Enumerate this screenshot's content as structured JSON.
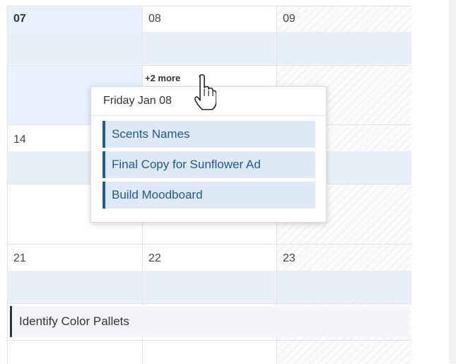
{
  "calendar": {
    "days": {
      "d07": "07",
      "d08": "08",
      "d09": "09",
      "d14": "14",
      "d21": "21",
      "d22": "22",
      "d23": "23"
    },
    "more_link": "+2 more",
    "long_event": "Identify Color Pallets"
  },
  "popup": {
    "title": "Friday Jan 08",
    "events": [
      {
        "label": "Scents Names"
      },
      {
        "label": "Final Copy for Sunflower Ad"
      },
      {
        "label": "Build Moodboard"
      }
    ]
  },
  "colors": {
    "event_accent": "#1f5f96",
    "event_bg": "#dde9f5",
    "today_bg": "#e7f1fb",
    "long_event_accent": "#2b3540"
  },
  "icons": {
    "cursor": "hand-pointer-cursor-icon"
  }
}
